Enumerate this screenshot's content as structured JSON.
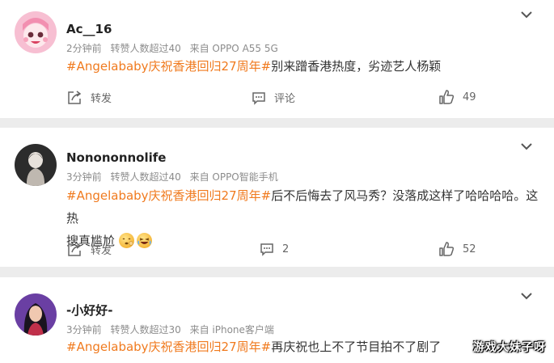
{
  "comments": [
    {
      "username": "Ac__16",
      "time": "2分钟前",
      "reposts": "转赞人数超过40",
      "source": "来自 OPPO A55 5G",
      "hashtag": "#Angelababy庆祝香港回归27周年#",
      "text": "别来蹭香港热度，劣迹艺人杨颖",
      "repost_label": "转发",
      "comment_label": "评论",
      "like_count": "49"
    },
    {
      "username": "Nonononnolife",
      "time": "3分钟前",
      "reposts": "转赞人数超过40",
      "source": "来自 OPPO智能手机",
      "hashtag": "#Angelababy庆祝香港回归27周年#",
      "text_line1": "后不后悔去了风马秀？没落成这样了哈哈哈哈。这热",
      "text_line2": "搜真尴尬",
      "comment_count": "2",
      "like_count": "52"
    },
    {
      "username": "-小好好-",
      "time": "3分钟前",
      "reposts": "转赞人数超过30",
      "source": "来自 iPhone客户端",
      "hashtag": "#Angelababy庆祝香港回归27周年#",
      "text": "再庆祝也上不了节目拍不了剧了"
    }
  ],
  "watermark": "游戏大妹子呀",
  "colors": {
    "hashtag": "#f07a1e",
    "background": "#ececec"
  },
  "icons": [
    "chevron-down-icon",
    "repost-icon",
    "comment-icon",
    "like-icon",
    "shy-emoji-icon",
    "laugh-emoji-icon"
  ]
}
